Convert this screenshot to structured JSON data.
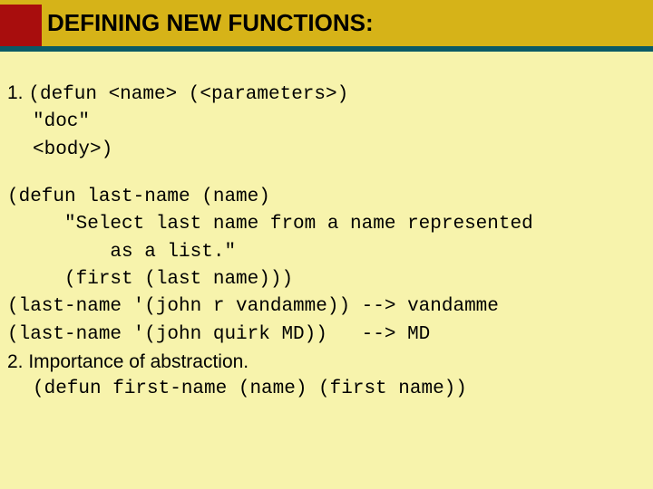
{
  "header": {
    "title": "DEFINING NEW FUNCTIONS:"
  },
  "section1": {
    "num": "1.",
    "line1": "(defun <name> (<parameters>)",
    "line2": "\"doc\"",
    "line3": "<body>)"
  },
  "defun": {
    "l1": "(defun last-name (name)",
    "l2": "     \"Select last name from a name represented",
    "l3": "         as a list.\"",
    "l4": "     (first (last name)))",
    "ex1": "(last-name '(john r vandamme)) --> vandamme",
    "ex2": "(last-name '(john quirk MD))   --> MD"
  },
  "section2": {
    "text": "2. Importance of abstraction.",
    "code": "(defun first-name (name) (first name))"
  }
}
